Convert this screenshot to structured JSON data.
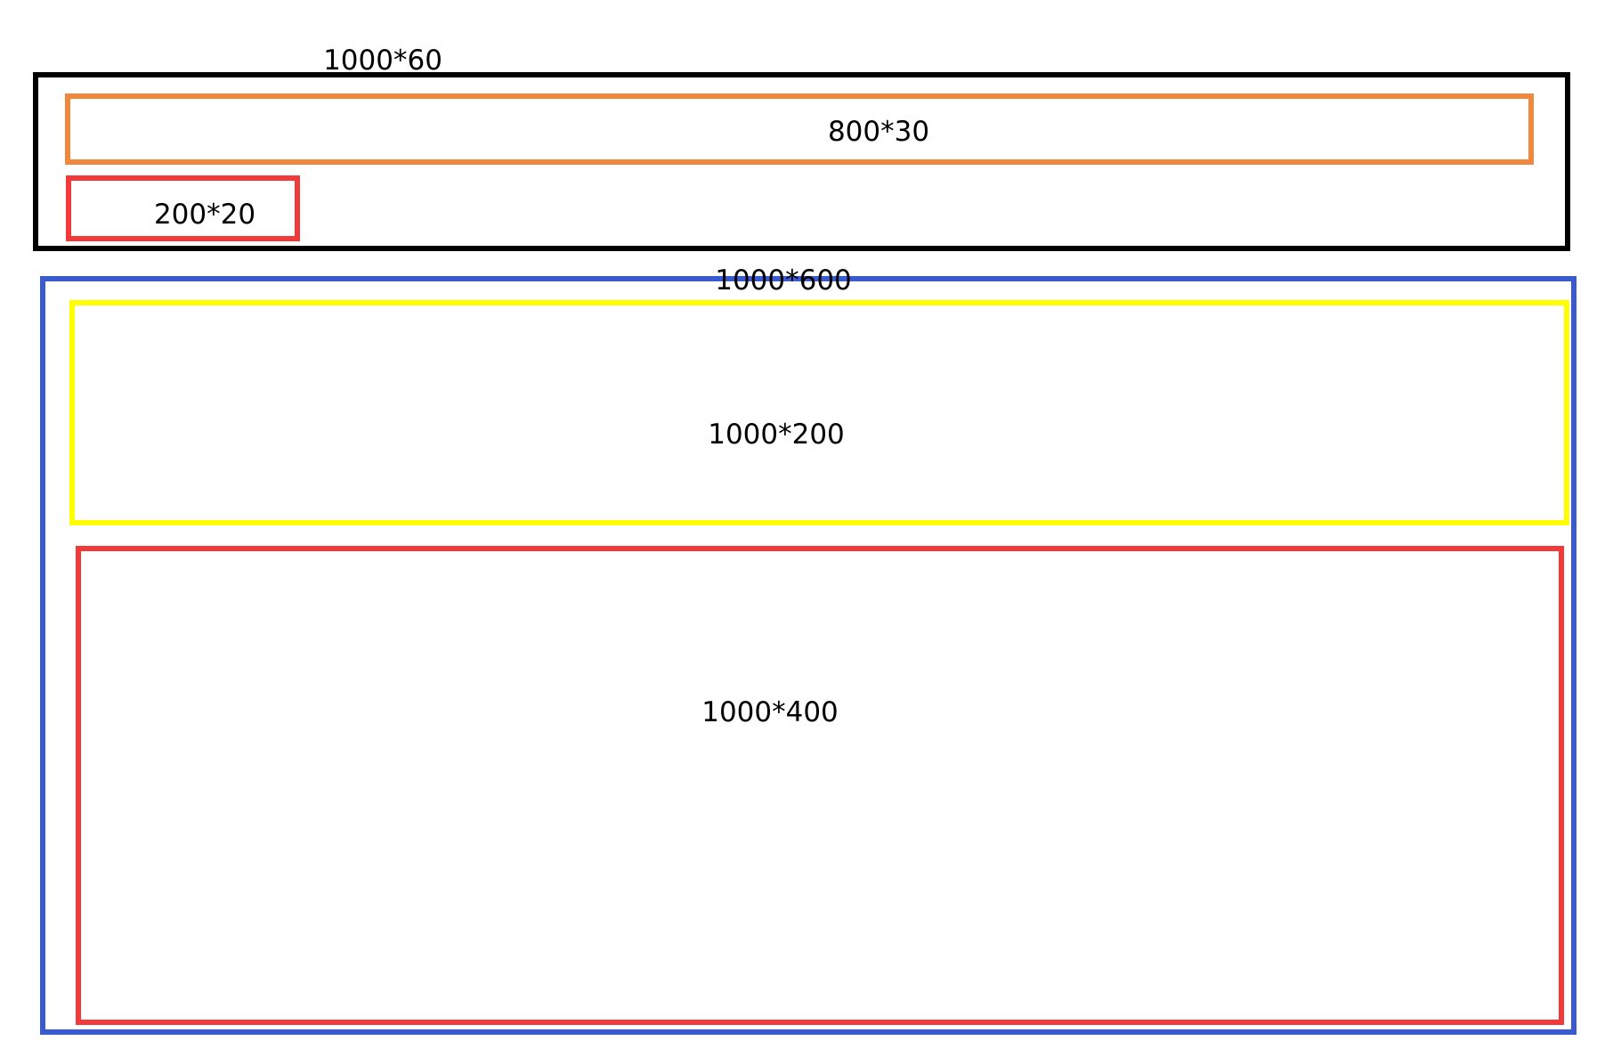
{
  "header": {
    "label": "1000*60",
    "border_color": "#000000",
    "nav": {
      "label": "800*30",
      "border_color": "#f0873c"
    },
    "logo": {
      "label": "200*20",
      "border_color": "#f23a3a"
    }
  },
  "main": {
    "label": "1000*600",
    "border_color": "#3a5bd0",
    "banner": {
      "label": "1000*200",
      "border_color": "#ffff00"
    },
    "content": {
      "label": "1000*400",
      "border_color": "#f23a3a"
    }
  }
}
